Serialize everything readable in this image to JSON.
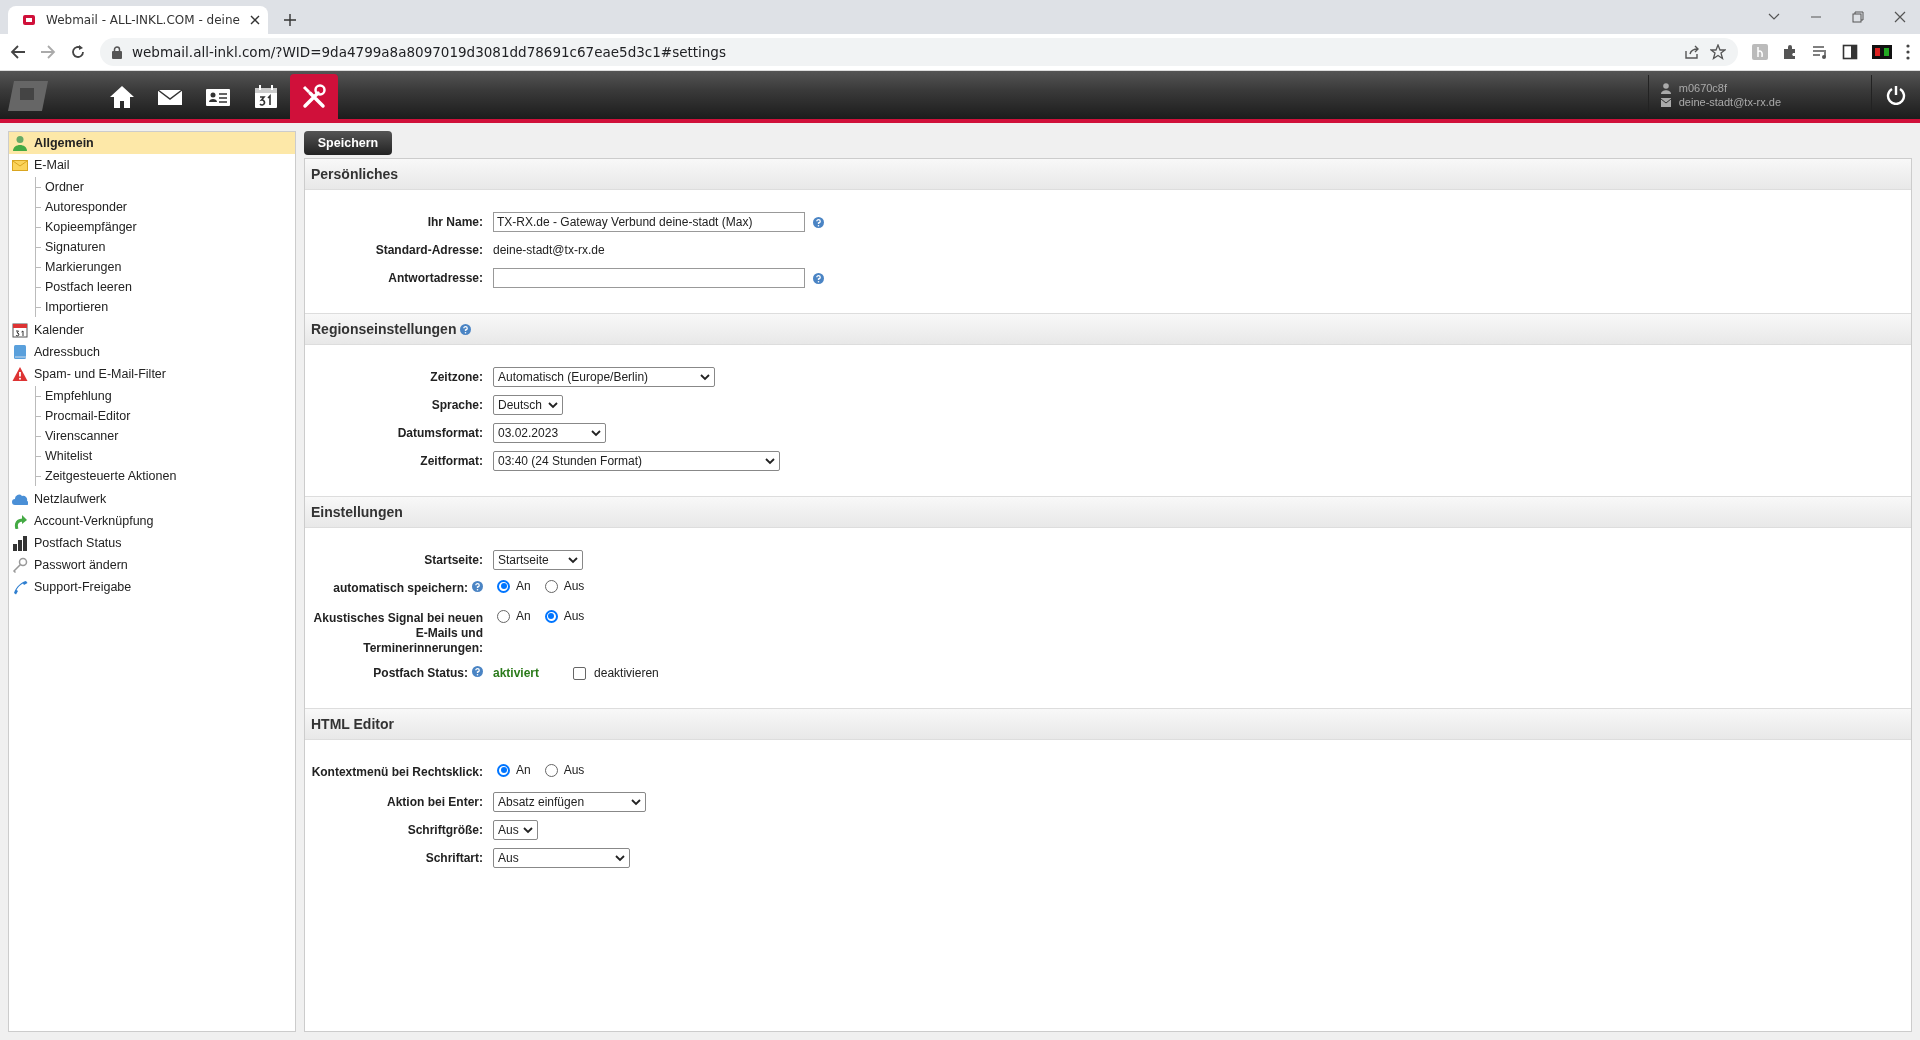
{
  "browser": {
    "tab_title": "Webmail - ALL-INKL.COM - deine",
    "url": "webmail.all-inkl.com/?WID=9da4799a8a8097019d3081dd78691c67eae5d3c1#settings"
  },
  "header": {
    "nav": [
      {
        "selected": false
      },
      {
        "selected": false
      },
      {
        "selected": false
      },
      {
        "selected": false
      },
      {
        "selected": true
      }
    ],
    "user": {
      "login": "m0670c8f",
      "email": "deine-stadt@tx-rx.de"
    }
  },
  "sidebar": {
    "items": [
      {
        "label": "Allgemein",
        "selected": true
      },
      {
        "label": "E-Mail",
        "selected": false,
        "children": [
          {
            "label": "Ordner",
            "selected": false
          },
          {
            "label": "Autoresponder",
            "selected": false
          },
          {
            "label": "Kopieempfänger",
            "selected": false
          },
          {
            "label": "Signaturen",
            "selected": false
          },
          {
            "label": "Markierungen",
            "selected": false
          },
          {
            "label": "Postfach leeren",
            "selected": false
          },
          {
            "label": "Importieren",
            "selected": false
          }
        ]
      },
      {
        "label": "Kalender",
        "selected": false
      },
      {
        "label": "Adressbuch",
        "selected": false
      },
      {
        "label": "Spam- und E-Mail-Filter",
        "selected": false,
        "children": [
          {
            "label": "Empfehlung",
            "selected": false
          },
          {
            "label": "Procmail-Editor",
            "selected": false
          },
          {
            "label": "Virenscanner",
            "selected": false
          },
          {
            "label": "Whitelist",
            "selected": false
          },
          {
            "label": "Zeitgesteuerte Aktionen",
            "selected": false
          }
        ]
      },
      {
        "label": "Netzlaufwerk",
        "selected": false
      },
      {
        "label": "Account-Verknüpfung",
        "selected": false
      },
      {
        "label": "Postfach Status",
        "selected": false
      },
      {
        "label": "Passwort ändern",
        "selected": false
      },
      {
        "label": "Support-Freigabe",
        "selected": false
      }
    ]
  },
  "save_button": "Speichern",
  "sections": [
    {
      "title": "Persönliches",
      "help": false,
      "rows": [
        {
          "kind": "input",
          "label": "Ihr Name:",
          "value": "TX-RX.de - Gateway Verbund deine-stadt (Max)",
          "help": true
        },
        {
          "kind": "static",
          "label": "Standard-Adresse:",
          "value": "deine-stadt@tx-rx.de",
          "help": false
        },
        {
          "kind": "input",
          "label": "Antwortadresse:",
          "value": "",
          "help": true
        }
      ]
    },
    {
      "title": "Regionseinstellungen",
      "help": true,
      "rows": [
        {
          "kind": "select",
          "label": "Zeitzone:",
          "value": "Automatisch (Europe/Berlin)",
          "help": false
        },
        {
          "kind": "select",
          "label": "Sprache:",
          "value": "Deutsch",
          "help": false
        },
        {
          "kind": "select",
          "label": "Datumsformat:",
          "value": "03.02.2023",
          "help": false
        },
        {
          "kind": "select",
          "label": "Zeitformat:",
          "value": "03:40 (24 Stunden Format)",
          "help": false
        }
      ]
    },
    {
      "title": "Einstellungen",
      "help": false,
      "rows": [
        {
          "kind": "select",
          "label": "Startseite:",
          "value": "Startseite",
          "help": false
        },
        {
          "kind": "radio",
          "label": "automatisch speichern:",
          "help": true,
          "options": [
            {
              "label": "An",
              "selected": true
            },
            {
              "label": "Aus",
              "selected": false
            }
          ]
        },
        {
          "kind": "radio",
          "label": "Akustisches Signal bei neuen E-Mails und Terminerinnerungen:",
          "help": false,
          "options": [
            {
              "label": "An",
              "selected": false
            },
            {
              "label": "Aus",
              "selected": true
            }
          ]
        },
        {
          "kind": "status",
          "label": "Postfach Status:",
          "help": true,
          "value": "aktiviert",
          "checkbox": {
            "label": "deaktivieren",
            "checked": false
          }
        }
      ]
    },
    {
      "title": "HTML Editor",
      "help": false,
      "rows": [
        {
          "kind": "radio",
          "label": "Kontextmenü bei Rechtsklick:",
          "help": false,
          "options": [
            {
              "label": "An",
              "selected": true
            },
            {
              "label": "Aus",
              "selected": false
            }
          ]
        },
        {
          "kind": "select",
          "label": "Aktion bei Enter:",
          "value": "Absatz einfügen",
          "help": false
        },
        {
          "kind": "select",
          "label": "Schriftgröße:",
          "value": "Aus",
          "help": false
        },
        {
          "kind": "select",
          "label": "Schriftart:",
          "value": "Aus",
          "help": false
        }
      ]
    }
  ]
}
